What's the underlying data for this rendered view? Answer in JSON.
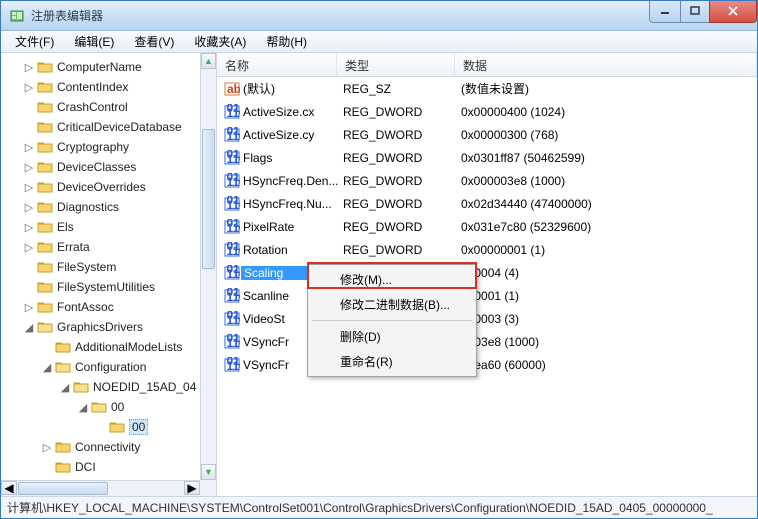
{
  "title": "注册表编辑器",
  "menu": [
    "文件(F)",
    "编辑(E)",
    "查看(V)",
    "收藏夹(A)",
    "帮助(H)"
  ],
  "tree": [
    {
      "d": 1,
      "t": "▷",
      "l": "ComputerName"
    },
    {
      "d": 1,
      "t": "▷",
      "l": "ContentIndex"
    },
    {
      "d": 1,
      "t": "",
      "l": "CrashControl"
    },
    {
      "d": 1,
      "t": "",
      "l": "CriticalDeviceDatabase"
    },
    {
      "d": 1,
      "t": "▷",
      "l": "Cryptography"
    },
    {
      "d": 1,
      "t": "▷",
      "l": "DeviceClasses"
    },
    {
      "d": 1,
      "t": "▷",
      "l": "DeviceOverrides"
    },
    {
      "d": 1,
      "t": "▷",
      "l": "Diagnostics"
    },
    {
      "d": 1,
      "t": "▷",
      "l": "Els"
    },
    {
      "d": 1,
      "t": "▷",
      "l": "Errata"
    },
    {
      "d": 1,
      "t": "",
      "l": "FileSystem"
    },
    {
      "d": 1,
      "t": "",
      "l": "FileSystemUtilities"
    },
    {
      "d": 1,
      "t": "▷",
      "l": "FontAssoc"
    },
    {
      "d": 1,
      "t": "◢",
      "l": "GraphicsDrivers"
    },
    {
      "d": 2,
      "t": "",
      "l": "AdditionalModeLists"
    },
    {
      "d": 2,
      "t": "◢",
      "l": "Configuration"
    },
    {
      "d": 3,
      "t": "◢",
      "l": "NOEDID_15AD_04"
    },
    {
      "d": 4,
      "t": "◢",
      "l": "00"
    },
    {
      "d": 5,
      "t": "",
      "l": "00",
      "sel": true
    },
    {
      "d": 2,
      "t": "▷",
      "l": "Connectivity"
    },
    {
      "d": 2,
      "t": "",
      "l": "DCI"
    }
  ],
  "cols": {
    "name": "名称",
    "type": "类型",
    "data": "数据"
  },
  "rows": [
    {
      "icon": "sz",
      "n": "(默认)",
      "t": "REG_SZ",
      "d": "(数值未设置)"
    },
    {
      "icon": "dw",
      "n": "ActiveSize.cx",
      "t": "REG_DWORD",
      "d": "0x00000400 (1024)"
    },
    {
      "icon": "dw",
      "n": "ActiveSize.cy",
      "t": "REG_DWORD",
      "d": "0x00000300 (768)"
    },
    {
      "icon": "dw",
      "n": "Flags",
      "t": "REG_DWORD",
      "d": "0x0301ff87 (50462599)"
    },
    {
      "icon": "dw",
      "n": "HSyncFreq.Den...",
      "t": "REG_DWORD",
      "d": "0x000003e8 (1000)"
    },
    {
      "icon": "dw",
      "n": "HSyncFreq.Nu...",
      "t": "REG_DWORD",
      "d": "0x02d34440 (47400000)"
    },
    {
      "icon": "dw",
      "n": "PixelRate",
      "t": "REG_DWORD",
      "d": "0x031e7c80 (52329600)"
    },
    {
      "icon": "dw",
      "n": "Rotation",
      "t": "REG_DWORD",
      "d": "0x00000001 (1)"
    },
    {
      "icon": "dw",
      "n": "Scaling",
      "t": "",
      "d": "000004 (4)",
      "sel": true
    },
    {
      "icon": "dw",
      "n": "Scanline",
      "t": "",
      "d": "000001 (1)"
    },
    {
      "icon": "dw",
      "n": "VideoSt",
      "t": "",
      "d": "000003 (3)"
    },
    {
      "icon": "dw",
      "n": "VSyncFr",
      "t": "",
      "d": "0003e8 (1000)"
    },
    {
      "icon": "dw",
      "n": "VSyncFr",
      "t": "",
      "d": "00ea60 (60000)"
    }
  ],
  "ctx": {
    "modify": "修改(M)...",
    "modifyBin": "修改二进制数据(B)...",
    "delete": "删除(D)",
    "rename": "重命名(R)"
  },
  "status": "计算机\\HKEY_LOCAL_MACHINE\\SYSTEM\\ControlSet001\\Control\\GraphicsDrivers\\Configuration\\NOEDID_15AD_0405_00000000_"
}
